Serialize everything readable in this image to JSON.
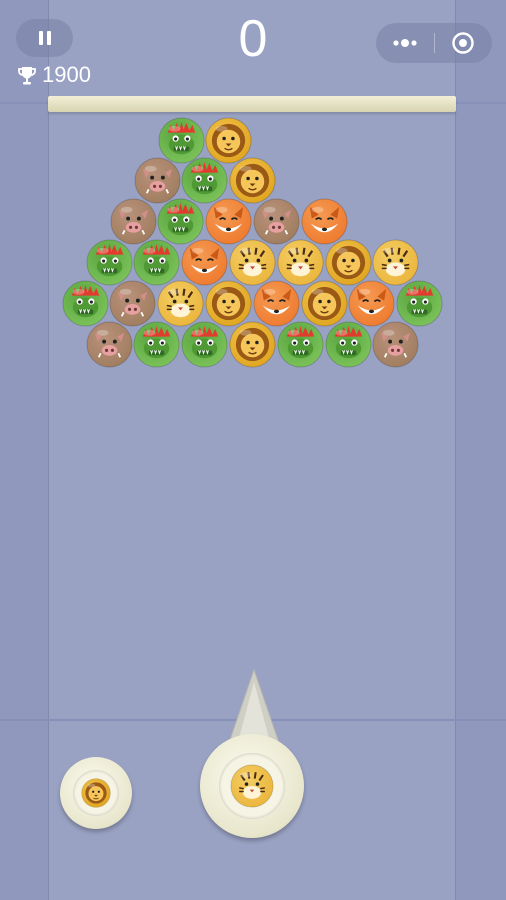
{
  "hud": {
    "score": "0",
    "best_score": "1900",
    "pause_icon": "pause-icon",
    "trophy_icon": "trophy-icon",
    "menu_icon": "more-dots-icon",
    "close_icon": "target-circle-icon"
  },
  "colors": {
    "background": "#9aa2c4",
    "side_panel": "#9099bd",
    "ceiling_bar": "#ece9cd",
    "shooter_ring": "#eeecd4"
  },
  "animals": {
    "dragon": {
      "icon": "dragon-icon",
      "fill": "#7cc35a",
      "face": "#5aa43f",
      "accent": "#e23b2e"
    },
    "lion": {
      "icon": "lion-icon",
      "fill": "#e0a51f",
      "face": "#f2c24a",
      "accent": "#8a4b12"
    },
    "boar": {
      "icon": "boar-icon",
      "fill": "#a07d5f",
      "face": "#b8917a",
      "accent": "#e6a0a0"
    },
    "fox": {
      "icon": "fox-icon",
      "fill": "#ee7a2e",
      "face": "#f59a52",
      "accent": "#ffffff"
    },
    "tiger": {
      "icon": "tiger-icon",
      "fill": "#ebb53b",
      "face": "#f3cd63",
      "accent": "#4a2a10"
    }
  },
  "grid": [
    [
      "dragon",
      "lion"
    ],
    [
      "boar",
      "dragon",
      "lion"
    ],
    [
      "boar",
      "dragon",
      "fox",
      "boar",
      "fox"
    ],
    [
      "dragon",
      "dragon",
      "fox",
      "tiger",
      "tiger",
      "lion",
      "tiger"
    ],
    [
      "dragon",
      "boar",
      "tiger",
      "lion",
      "fox",
      "lion",
      "fox",
      "dragon"
    ],
    [
      "boar",
      "dragon",
      "dragon",
      "lion",
      "dragon",
      "dragon",
      "boar"
    ]
  ],
  "current_bubble": "tiger",
  "next_bubble": "lion"
}
